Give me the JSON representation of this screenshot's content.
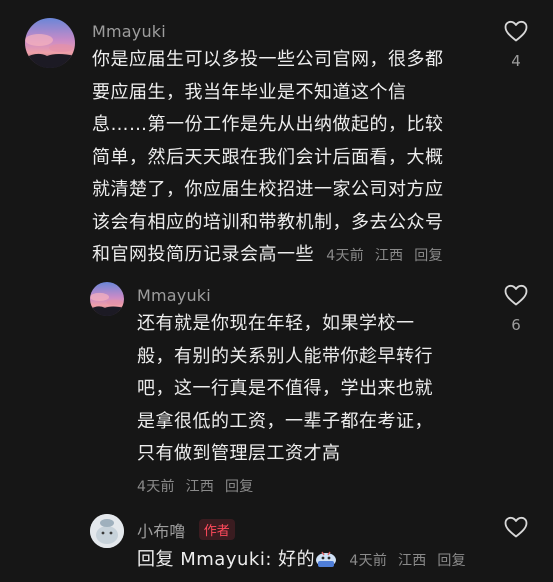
{
  "comments": [
    {
      "username": "Mmayuki",
      "lines": [
        "你是应届生可以多投一些公司官网，很多都",
        "要应届生，我当年毕业是不知道这个信",
        "息……第一份工作是先从出纳做起的，比较",
        "简单，然后天天跟在我们会计后面看，大概",
        "就清楚了，你应届生校招进一家公司对方应",
        "该会有相应的培训和带教机制，多去公众号",
        "和官网投简历记录会高一些"
      ],
      "time": "4天前",
      "location": "江西",
      "reply_label": "回复",
      "like_count": "4"
    },
    {
      "username": "Mmayuki",
      "lines": [
        "还有就是你现在年轻，如果学校一",
        "般，有别的关系别人能带你趁早转行",
        "吧，这一行真是不值得，学出来也就",
        "是拿很低的工资，一辈子都在考证，",
        "只有做到管理层工资才高"
      ],
      "time": "4天前",
      "location": "江西",
      "reply_label": "回复",
      "like_count": "6"
    },
    {
      "username": "小布噜",
      "badge": "作者",
      "reply_prefix": "回复",
      "mention": "Mmayuki:",
      "text": "好的",
      "time": "4天前",
      "location": "江西",
      "reply_label": "回复"
    }
  ],
  "icons": {
    "like": "heart-outline-icon",
    "reaction_emoji": "emoji-sticker-icon"
  }
}
